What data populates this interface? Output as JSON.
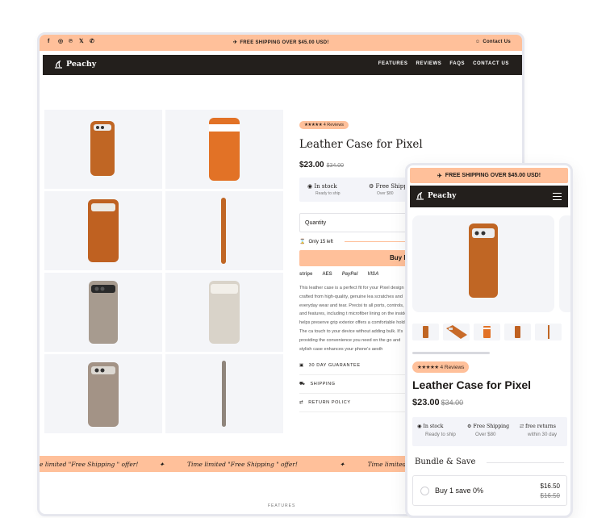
{
  "desktop": {
    "social_icons": [
      "facebook-icon",
      "instagram-icon",
      "pinterest-icon",
      "x-icon",
      "whatsapp-icon"
    ],
    "announcement": "FREE SHIPPING OVER $45.00 USD!",
    "contact_link": "Contact Us",
    "brand": "Peachy",
    "nav": [
      "FEATURES",
      "REVIEWS",
      "FAQS",
      "CONTACT US"
    ],
    "product": {
      "reviews_badge": "4 Reviews",
      "stars": "★★★★★",
      "title": "Leather Case for Pixel",
      "price": "$23.00",
      "compare_price": "$34.00",
      "stock_label": "In stock",
      "stock_sub": "Ready to ship",
      "shipping_label": "Free Shipping",
      "shipping_sub": "Over $80",
      "quantity_label": "Quantity",
      "only_left": "Only 15 left",
      "buy_label": "Buy No",
      "payments": [
        "stripe",
        "AES",
        "PayPal",
        "VISA"
      ],
      "description": "This leather case is a perfect fit for your Pixel design crafted from high-quality, genuine lea scratches and everyday wear and tear. Precisi to all ports, controls, and features, including t microfiber lining on the inside helps preserve grip exterior offers a comfortable hold. The ca touch to your device without adding bulk. It's providing the convenience you need on the go and stylish case enhances your phone's aesth",
      "accordion": [
        "30 DAY GUARANTEE",
        "SHIPPING",
        "RETURN POLICY"
      ]
    },
    "marquee": [
      "e limited \"Free Shipping \" offer!",
      "Time limited \"Free Shipping \" offer!",
      "Time limited \"Free Shipping \" offer!"
    ],
    "features_heading": "FEATURES"
  },
  "mobile": {
    "announcement": "FREE SHIPPING OVER $45.00 USD!",
    "brand": "Peachy",
    "reviews_badge": "4 Reviews",
    "stars": "★★★★★",
    "title": "Leather Case for Pixel",
    "price": "$23.00",
    "compare_price": "$34.00",
    "stock_label": "In stock",
    "stock_sub": "Ready to ship",
    "shipping_label": "Free Shipping",
    "shipping_sub": "Over $80",
    "returns_label": "free returns",
    "returns_sub": "within 30 day",
    "bundle_heading": "Bundle & Save",
    "bundle_option": {
      "label": "Buy 1 save 0%",
      "price": "$16.50",
      "compare_price": "$16.50"
    }
  },
  "colors": {
    "accent": "#ffc09a",
    "nav_bg": "#231f1c",
    "case_orange": "#c06624",
    "case_taupe": "#a79b8f"
  }
}
